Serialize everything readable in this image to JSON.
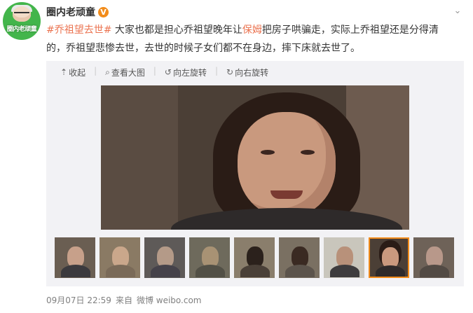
{
  "user": {
    "name": "圈内老顽童",
    "avatar_text": "圈内老顽童",
    "badge": "V"
  },
  "post": {
    "hashtag": "#乔祖望去世#",
    "text_a": " 大家也都是担心乔祖望晚年让",
    "highlight": "保姆",
    "text_b": "把房子哄骗走，实际上乔祖望还是分得清",
    "line2": "的，乔祖望悲惨去世，去世的时候子女们都不在身边，摔下床就去世了。"
  },
  "toolbar": {
    "collapse_label": "收起",
    "view_large_label": "查看大图",
    "rotate_left_label": "向左旋转",
    "rotate_right_label": "向右旋转"
  },
  "thumbnails": {
    "count": 9,
    "active_index": 7
  },
  "footer": {
    "timestamp": "09月07日 22:59",
    "from_label": "来自",
    "source": "微博 weibo.com"
  },
  "colors": {
    "accent": "#eb7350",
    "badge": "#f28c1b",
    "media_bg": "#f2f2f5"
  }
}
